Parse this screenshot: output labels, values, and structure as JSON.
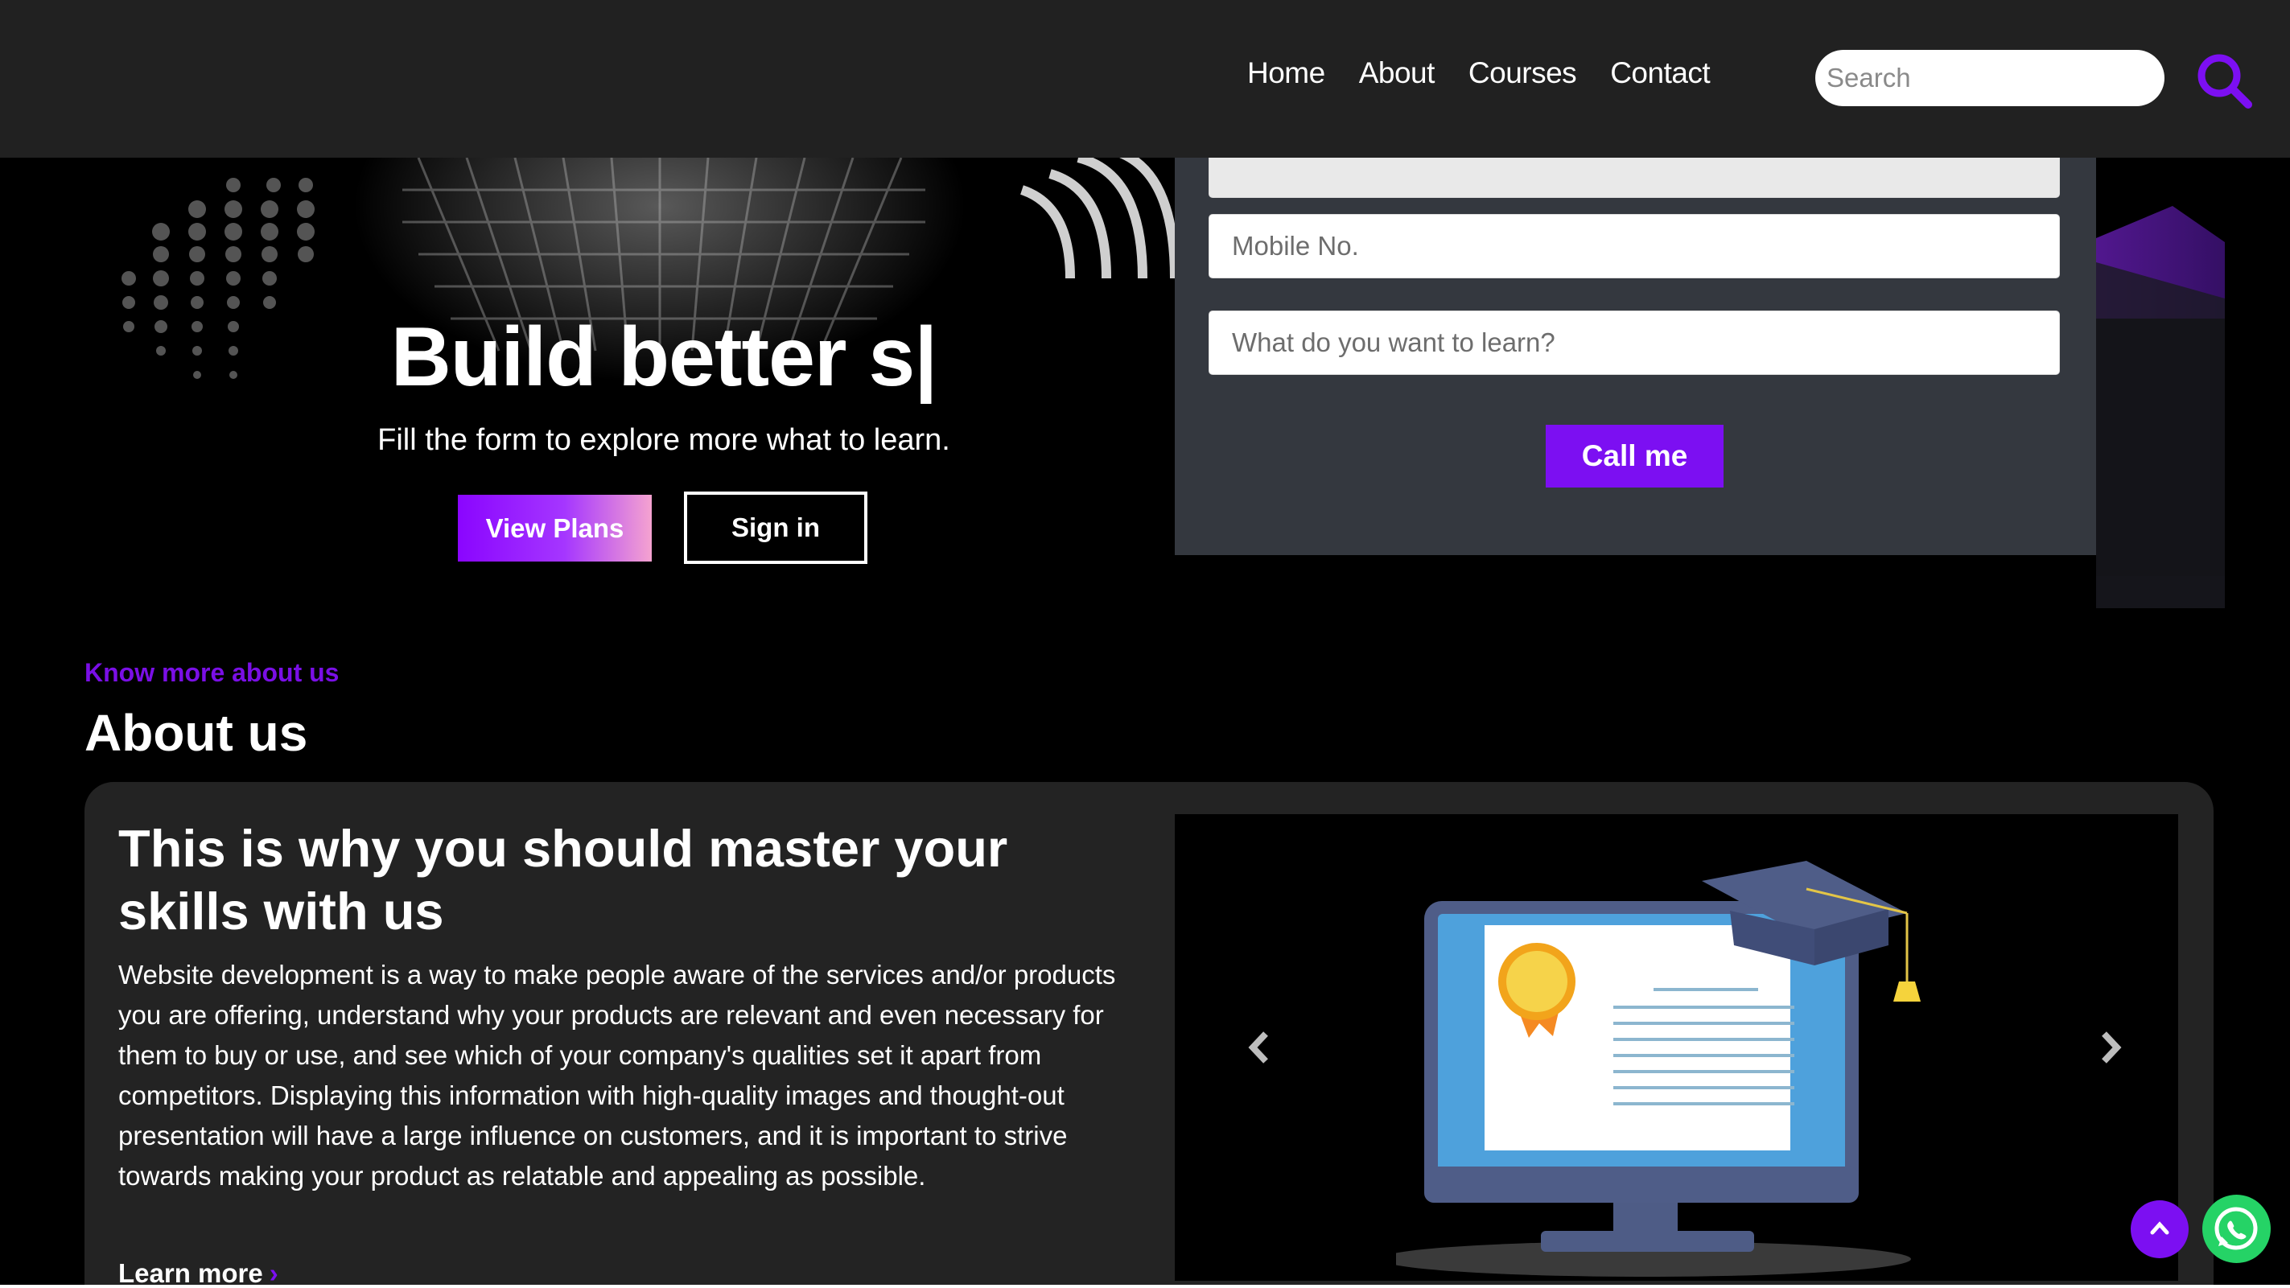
{
  "nav": {
    "links": [
      "Home",
      "About",
      "Courses",
      "Contact"
    ],
    "search_placeholder": "Search"
  },
  "hero": {
    "title": "Build better s|",
    "subtitle": "Fill the form to explore more what to learn.",
    "view_plans_label": "View Plans",
    "sign_in_label": "Sign in"
  },
  "form": {
    "mobile_placeholder": "Mobile No.",
    "learn_placeholder": "What do you want to learn?",
    "submit_label": "Call me"
  },
  "about": {
    "kicker": "Know more about us",
    "title": "About us",
    "card_heading": "This is why you should master your skills with us",
    "card_body": "Website development is a way to make people aware of the services and/or products you are offering, understand why your products are relevant and even necessary for them to buy or use, and see which of your company's qualities set it apart from competitors. Displaying this information with high-quality images and thought-out presentation will have a large influence on customers, and it is important to strive towards making your product as relatable and appealing as possible.",
    "learn_more_label": "Learn more",
    "learn_more_chevron": "›"
  },
  "floating": {
    "to_top_icon": "chevron-up-icon",
    "whatsapp_icon": "whatsapp-icon"
  },
  "colors": {
    "accent": "#7c0ff2",
    "navbar_bg": "#212121",
    "panel_bg": "#34383f",
    "card_bg": "#232323",
    "whatsapp": "#25d366"
  }
}
